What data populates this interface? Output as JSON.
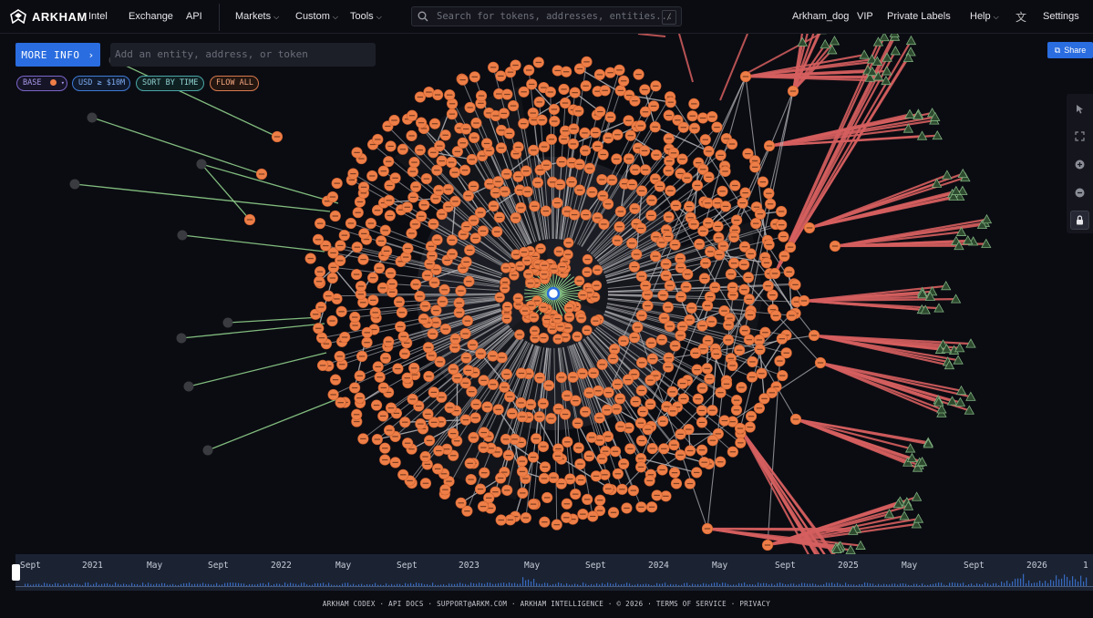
{
  "brand": {
    "name": "ARKHAM"
  },
  "nav": {
    "intel": "Intel",
    "exchange": "Exchange",
    "api": "API",
    "markets": "Markets",
    "custom": "Custom",
    "tools": "Tools",
    "user": "Arkham_dog",
    "vip": "VIP",
    "private_labels": "Private Labels",
    "help": "Help",
    "settings": "Settings"
  },
  "search": {
    "placeholder": "Search for tokens, addresses, entities...",
    "shortcut": "/"
  },
  "visualizer": {
    "more_info_label": "MORE INFO",
    "entity_placeholder": "Add an entity, address, or token",
    "filters": {
      "base": "BASE",
      "usd": "USD ≥ $10M",
      "sort": "SORT BY TIME",
      "flow": "FLOW ALL"
    },
    "share_label": "Share",
    "tools": [
      "cursor-icon",
      "expand-icon",
      "zoom-in-icon",
      "zoom-out-icon",
      "lock-icon"
    ]
  },
  "timeline": {
    "labels": [
      "Sept",
      "2021",
      "May",
      "Sept",
      "2022",
      "May",
      "Sept",
      "2023",
      "May",
      "Sept",
      "2024",
      "May",
      "Sept",
      "2025",
      "May",
      "Sept",
      "2026",
      "1"
    ]
  },
  "footer": {
    "text": "ARKHAM CODEX · API DOCS · SUPPORT@ARKM.COM · ARKHAM INTELLIGENCE · © 2026 · TERMS OF SERVICE · PRIVACY"
  },
  "colors": {
    "background": "#0b0c12",
    "node_orange": "#ee7e47",
    "edge_gray": "#b8b8bc",
    "edge_red": "#d65f5f",
    "edge_green": "#8fd08a",
    "accent_blue": "#2a6de0",
    "timeline_bg": "#1b2333"
  }
}
